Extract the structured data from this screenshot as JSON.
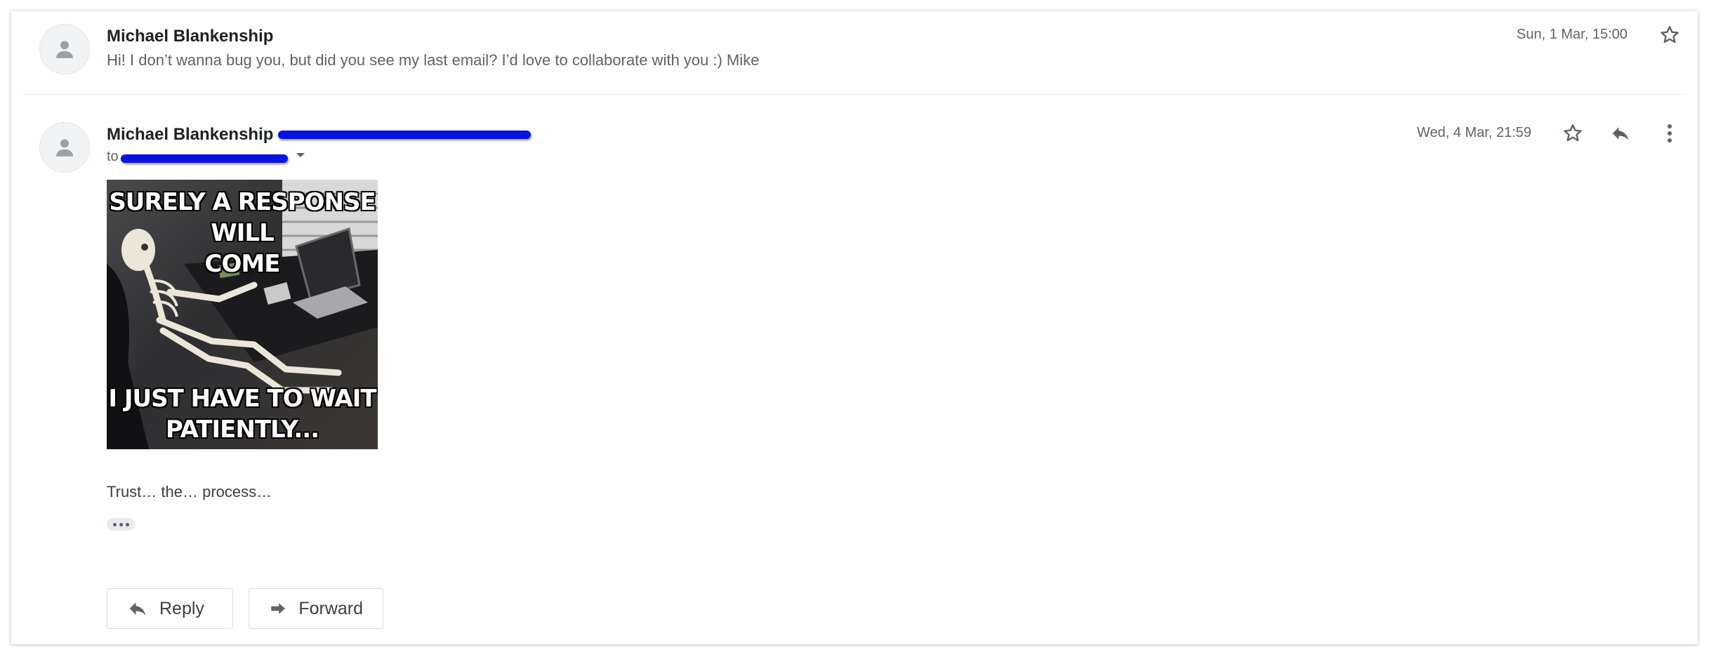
{
  "thread": {
    "collapsed": {
      "sender": "Michael Blankenship",
      "snippet": "Hi! I don’t wanna bug you, but did you see my last email? I’d love to collaborate with you :) Mike",
      "date": "Sun, 1 Mar, 15:00"
    },
    "expanded": {
      "sender": "Michael Blankenship",
      "to_prefix": "to",
      "date": "Wed, 4 Mar, 21:59",
      "image_top_text": "SURELY A RESPONSE WILL\nCOME",
      "image_bottom_text": "I JUST HAVE TO WAIT\nPATIENTLY...",
      "body": "Trust… the… process…"
    },
    "actions": {
      "reply_label": "Reply",
      "forward_label": "Forward"
    }
  },
  "colors": {
    "redaction": "#0a14d8",
    "icon": "#5f6368"
  },
  "icons": [
    "person-icon",
    "star-icon",
    "reply-icon",
    "more-vert-icon",
    "dropdown-arrow-icon",
    "forward-icon"
  ]
}
